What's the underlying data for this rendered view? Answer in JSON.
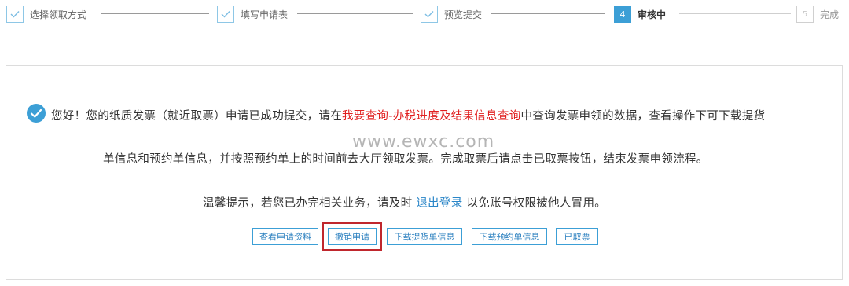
{
  "steps": [
    {
      "label": "选择领取方式",
      "state": "done",
      "icon": "check-icon"
    },
    {
      "label": "填写申请表",
      "state": "done",
      "icon": "check-icon"
    },
    {
      "label": "预览提交",
      "state": "done",
      "icon": "check-icon"
    },
    {
      "number": "4",
      "label": "审核中",
      "state": "active"
    },
    {
      "number": "5",
      "label": "完成",
      "state": "todo"
    }
  ],
  "message": {
    "line1_prefix": "您好！您的纸质发票（就近取票）申请已成功提交，请在",
    "line1_highlight": "我要查询-办税进度及结果信息查询",
    "line1_suffix": "中查询发票申领的数据，查看操作下可下载提货",
    "line2": "单信息和预约单信息，并按照预约单上的时间前去大厅领取发票。完成取票后请点击已取票按钮，结束发票申领流程。",
    "line3_prefix": "温馨提示，若您已办完相关业务，请及时",
    "logout_link": "退出登录",
    "line3_suffix": "以免账号权限被他人冒用。"
  },
  "watermark": "www.ewxc.com",
  "buttons": {
    "view": "查看申请资料",
    "revoke": "撤销申请",
    "download_pickup": "下载提货单信息",
    "download_appointment": "下载预约单信息",
    "picked_up": "已取票"
  },
  "colors": {
    "accent": "#3c9fd6",
    "highlight_text": "#e02020",
    "annotation_box": "#c0272d"
  }
}
